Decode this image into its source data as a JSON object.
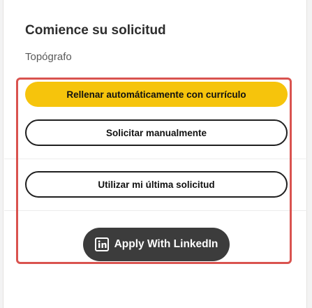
{
  "application": {
    "title": "Comience su solicitud",
    "job_title": "Topógrafo"
  },
  "actions": {
    "autofill_label": "Rellenar automáticamente con currículo",
    "manual_label": "Solicitar manualmente",
    "last_application_label": "Utilizar mi última solicitud",
    "linkedin_label": "Apply With LinkedIn"
  },
  "icons": {
    "linkedin": "linkedin-icon"
  },
  "colors": {
    "autofill_button": "#f6c40c",
    "linkedin_button": "#3c3c3c",
    "highlight_border": "#d9534f"
  }
}
